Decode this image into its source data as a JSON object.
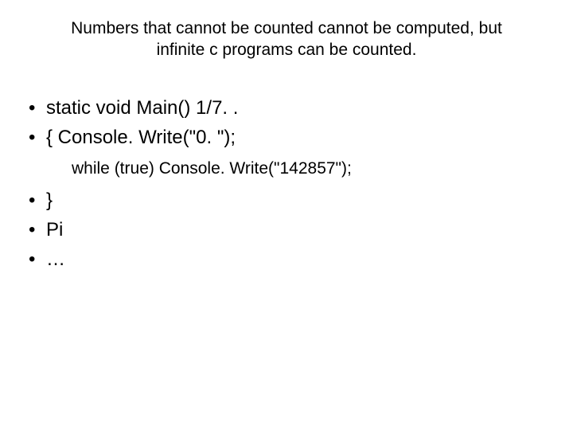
{
  "title_line1": "Numbers that cannot be counted cannot be computed, but",
  "title_line2": "infinite c programs can be counted.",
  "bullets": {
    "b1": "static void Main() 1/7. .",
    "b2": "{ Console. Write(\"0. \");",
    "sub": "while (true) Console. Write(\"142857\");",
    "b3": " }",
    "b4": "Pi",
    "b5": "…"
  },
  "dot": "•"
}
